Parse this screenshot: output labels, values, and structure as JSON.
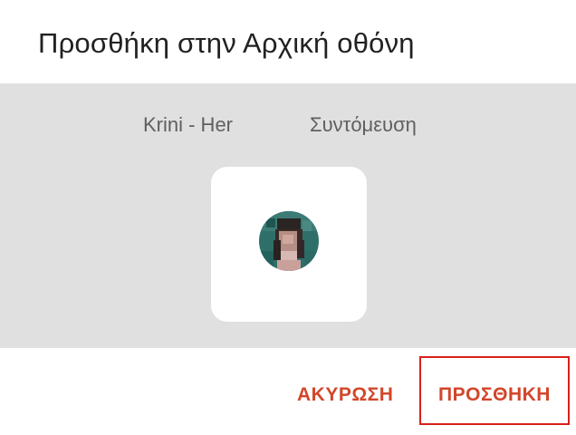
{
  "dialog": {
    "title": "Προσθήκη στην Αρχική οθόνη",
    "app_name": "Krini - Her",
    "shortcut_label": "Συντόμευση",
    "icon": "avatar-photo",
    "cancel_label": "ΑΚΥΡΩΣΗ",
    "add_label": "ΠΡΟΣΘΗΚΗ",
    "accent_color": "#d2462a",
    "highlight_color": "#d9201a"
  }
}
